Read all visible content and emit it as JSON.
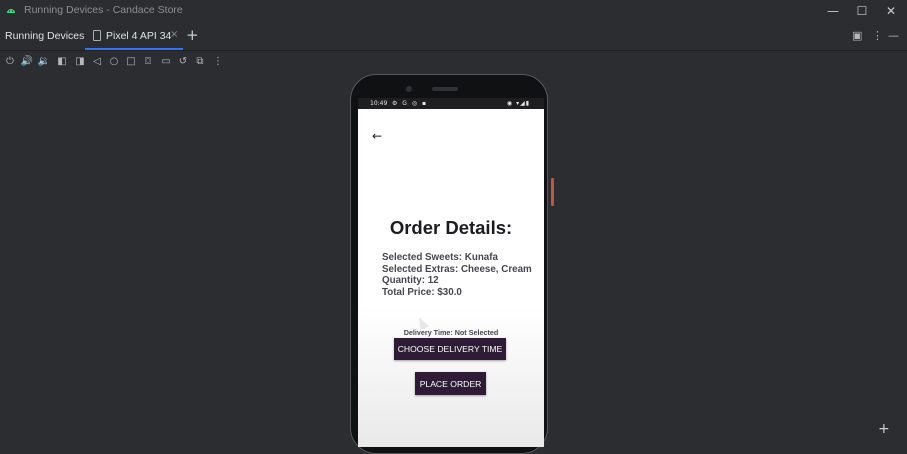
{
  "window": {
    "title": "Running Devices - Candace Store",
    "controls": {
      "minimize": "—",
      "maximize": "☐",
      "close": "✕"
    }
  },
  "tabbar": {
    "panel_title": "Running Devices",
    "tab_label": "Pixel 4 API 34",
    "tab_close": "×",
    "add_tab": "+"
  },
  "toolbar": {
    "icons": [
      "power-icon",
      "volume-up-icon",
      "volume-down-icon",
      "rotate-left-icon",
      "rotate-right-icon",
      "back-icon",
      "home-icon",
      "overview-icon",
      "screenshot-icon",
      "screen-record-icon",
      "reset-icon",
      "device-frame-icon",
      "more-icon"
    ]
  },
  "device": {
    "status_time": "10:49",
    "status_icons": "⚙ G ◎ ▪",
    "status_right": "◉ ▾◢▮",
    "back_glyph": "←",
    "heading": "Order Details:",
    "details": [
      "Selected Sweets: Kunafa",
      "Selected Extras: Cheese, Cream",
      "Quantity: 12",
      "Total Price: $30.0"
    ],
    "delivery_time": "Delivery Time: Not Selected",
    "choose_delivery_label": "CHOOSE DELIVERY TIME",
    "place_order_label": "PLACE ORDER"
  },
  "colors": {
    "ide_background": "#2b2d30",
    "accent_tab": "#3574f0",
    "button": "#2e1c36",
    "side_button": "#c4553e"
  }
}
